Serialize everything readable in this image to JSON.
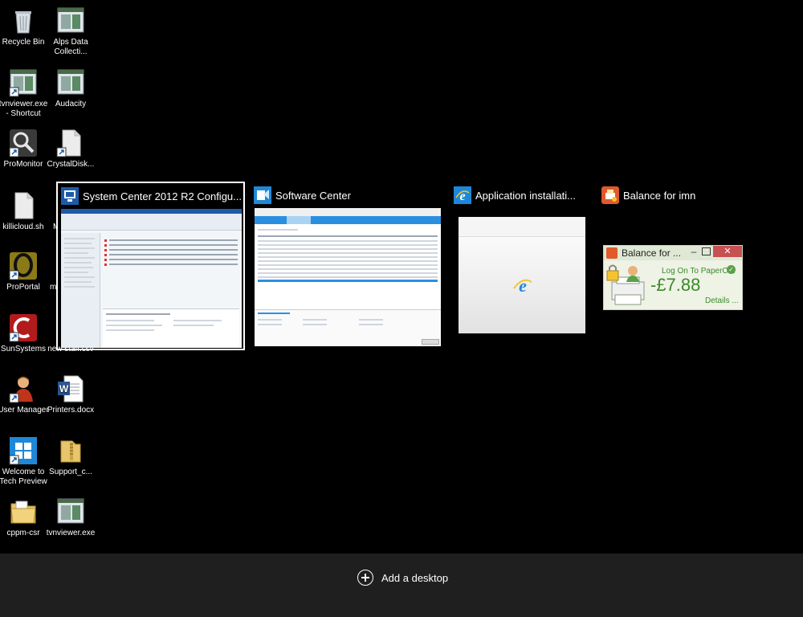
{
  "desktop_icons": [
    {
      "id": "recycle-bin",
      "label": "Recycle Bin",
      "icon": "recycle-bin-icon"
    },
    {
      "id": "alps",
      "label": "Alps Data Collecti...",
      "icon": "app-window-icon"
    },
    {
      "id": "tvnviewer-shortcut",
      "label": "tvnviewer.exe - Shortcut",
      "icon": "app-window-icon"
    },
    {
      "id": "audacity",
      "label": "Audacity",
      "icon": "app-window-icon"
    },
    {
      "id": "promonitor",
      "label": "ProMonitor",
      "icon": "magnifier-icon"
    },
    {
      "id": "crystaldisk",
      "label": "CrystalDisk...",
      "icon": "file-icon"
    },
    {
      "id": "killicloud",
      "label": "killicloud.sh",
      "icon": "file-icon"
    },
    {
      "id": "m-partial",
      "label": "M",
      "icon": "file-icon"
    },
    {
      "id": "proportal",
      "label": "ProPortal",
      "icon": "proportal-icon"
    },
    {
      "id": "m-partial-2",
      "label": "m",
      "icon": "file-icon"
    },
    {
      "id": "sunsystems",
      "label": "SunSystems",
      "icon": "sunsystems-icon"
    },
    {
      "id": "newstaff",
      "label": "new staff.csv",
      "icon": "file-icon"
    },
    {
      "id": "usermanager",
      "label": "User Manager",
      "icon": "user-icon"
    },
    {
      "id": "printers",
      "label": "Printers.docx",
      "icon": "word-doc-icon"
    },
    {
      "id": "welcome",
      "label": "Welcome to Tech Preview",
      "icon": "windows-logo-icon"
    },
    {
      "id": "support",
      "label": "Support_c...",
      "icon": "folder-zip-icon"
    },
    {
      "id": "cppm",
      "label": "cppm-csr",
      "icon": "folder-icon"
    },
    {
      "id": "tvnviewer",
      "label": "tvnviewer.exe",
      "icon": "app-window-icon"
    }
  ],
  "task_view": {
    "windows": [
      {
        "title": "System Center 2012 R2 Configu...",
        "icon": "sccm-icon",
        "selected": true
      },
      {
        "title": "Software Center",
        "icon": "software-center-icon",
        "selected": false
      },
      {
        "title": "Application installati...",
        "icon": "internet-explorer-icon",
        "selected": false
      },
      {
        "title": "Balance for imn",
        "icon": "papercut-icon",
        "selected": false
      }
    ],
    "papercut": {
      "title": "Balance for ...",
      "login_link": "Log On To PaperCut",
      "balance": "-£7.88",
      "details_link": "Details ..."
    }
  },
  "bottom_bar": {
    "add_desktop_label": "Add a desktop"
  },
  "colors": {
    "background": "#000000",
    "bottom_bar": "#1f1f1f",
    "selection_border": "#ffffff",
    "papercut_green": "#3d8a2a",
    "accent_blue": "#2b8fe0"
  }
}
